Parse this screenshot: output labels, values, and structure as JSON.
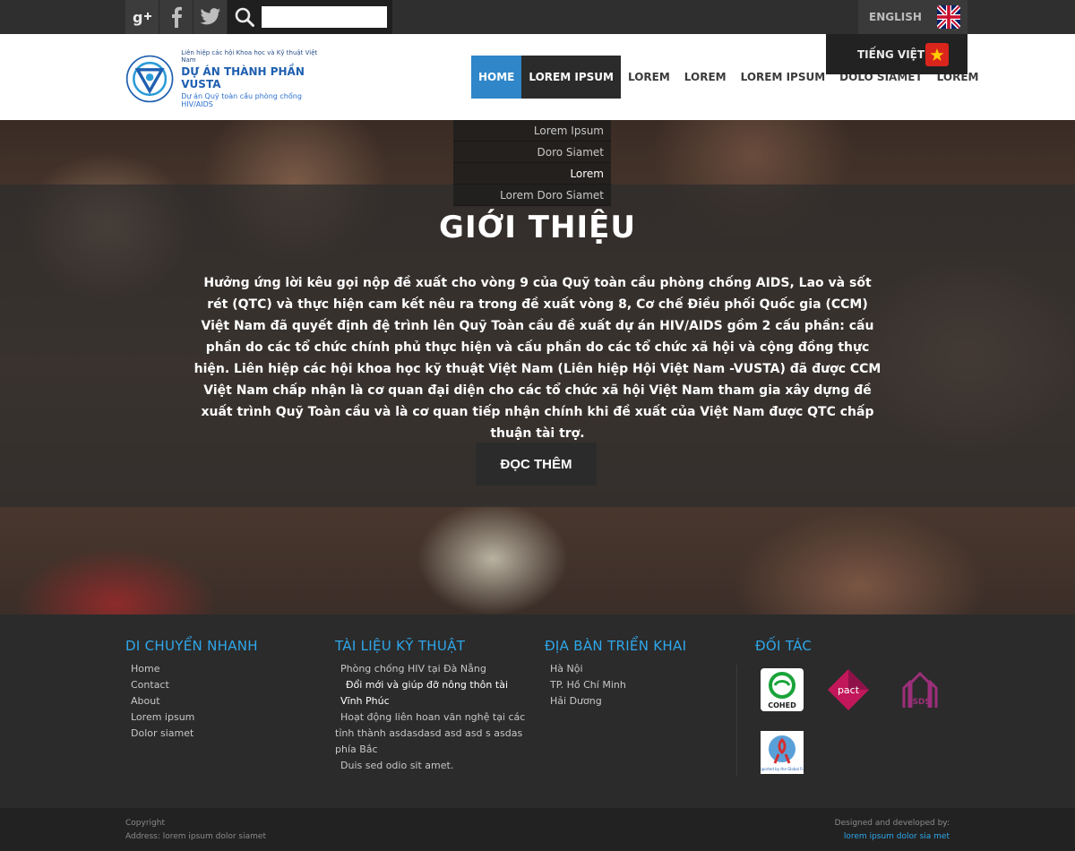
{
  "top": {
    "social": [
      {
        "icon": "google-plus-icon",
        "label": "g+"
      },
      {
        "icon": "facebook-icon",
        "label": "f"
      },
      {
        "icon": "twitter-icon",
        "label": ""
      }
    ],
    "search": {
      "placeholder": "",
      "value": ""
    },
    "languages": {
      "en": {
        "label": "ENGLISH"
      },
      "vn": {
        "label": "TIẾNG VIỆT"
      }
    }
  },
  "header": {
    "logo": {
      "line1": "Liên hiệp các hội Khoa học và Kỹ thuật Việt Nam",
      "line2": "DỰ ÁN THÀNH PHẦN VUSTA",
      "line3": "Dự án Quỹ toàn cầu phòng chống HIV/AIDS"
    },
    "nav": [
      {
        "label": "HOME"
      },
      {
        "label": "LOREM IPSUM"
      },
      {
        "label": "LOREM"
      },
      {
        "label": "LOREM"
      },
      {
        "label": "LOREM IPSUM"
      },
      {
        "label": "DOLO SIAMET"
      },
      {
        "label": "LOREM"
      }
    ],
    "dropdown": [
      {
        "label": "Lorem Ipsum"
      },
      {
        "label": "Doro Siamet"
      },
      {
        "label": "Lorem"
      },
      {
        "label": "Lorem Doro Siamet"
      }
    ]
  },
  "hero": {
    "title": "GIỚI THIỆU",
    "text": "Hưởng ứng lời kêu gọi nộp đề xuất cho vòng 9 của Quỹ toàn cầu phòng chống AIDS, Lao và sốt rét (QTC) và thực hiện cam kết nêu ra trong đề xuất vòng 8, Cơ chế Điều phối Quốc gia (CCM) Việt Nam đã quyết định đệ trình lên Quỹ Toàn cầu đề xuất dự án HIV/AIDS gồm 2 cấu phần: cấu phần do các tổ chức chính phủ thực hiện và cấu phần do các tổ chức xã hội và cộng đồng thực hiện. Liên hiệp các hội khoa học kỹ thuật Việt Nam (Liên hiệp Hội Việt Nam -VUSTA) đã được CCM Việt Nam chấp nhận là cơ quan đại diện cho các tổ chức xã hội Việt Nam tham gia xây dựng đề xuất trình Quỹ Toàn cầu và là cơ quan tiếp nhận chính khi đề xuất của Việt Nam được QTC chấp thuận tài trợ.",
    "button": "ĐỌC THÊM"
  },
  "footer": {
    "col1": {
      "title": "DI CHUYỂN NHANH",
      "links": [
        "Home",
        "Contact",
        "About",
        "Lorem ipsum",
        "Dolor siamet"
      ]
    },
    "col2": {
      "title": "TÀI LIỆU KỸ THUẬT",
      "links": [
        "Phòng chống HIV tại Đà Nẵng",
        "Đổi mới và giúp đỡ nông thôn tài Vĩnh Phúc",
        "Hoạt động liên hoan văn nghệ tại các tỉnh thành asdasdasd asd asd s asdas phía Bắc",
        "Duis sed odio sit amet."
      ]
    },
    "col3": {
      "title": "ĐỊA BÀN TRIỂN KHAI",
      "links": [
        "Hà Nội",
        "TP. Hồ Chí Minh",
        "Hải Dương"
      ]
    },
    "col4": {
      "title": "ĐỐI TÁC",
      "partners": [
        {
          "icon": "cohed-logo-icon",
          "label": "COHED"
        },
        {
          "icon": "pact-logo-icon",
          "label": "pact"
        },
        {
          "icon": "isds-logo-icon",
          "label": "ISDS"
        },
        {
          "icon": "global-fund-logo-icon",
          "label": "Supported by the Global Fund"
        }
      ]
    }
  },
  "bottom": {
    "copyright": "Copyright",
    "address": "Address: lorem ipsum dolor siamet",
    "designed_by": "Designed and developed by:",
    "designer": "lorem ipsum dolor sia met"
  },
  "colors": {
    "accent": "#2f86c9",
    "footer_heading": "#2ea7ea",
    "dark": "#2b2b2b"
  }
}
